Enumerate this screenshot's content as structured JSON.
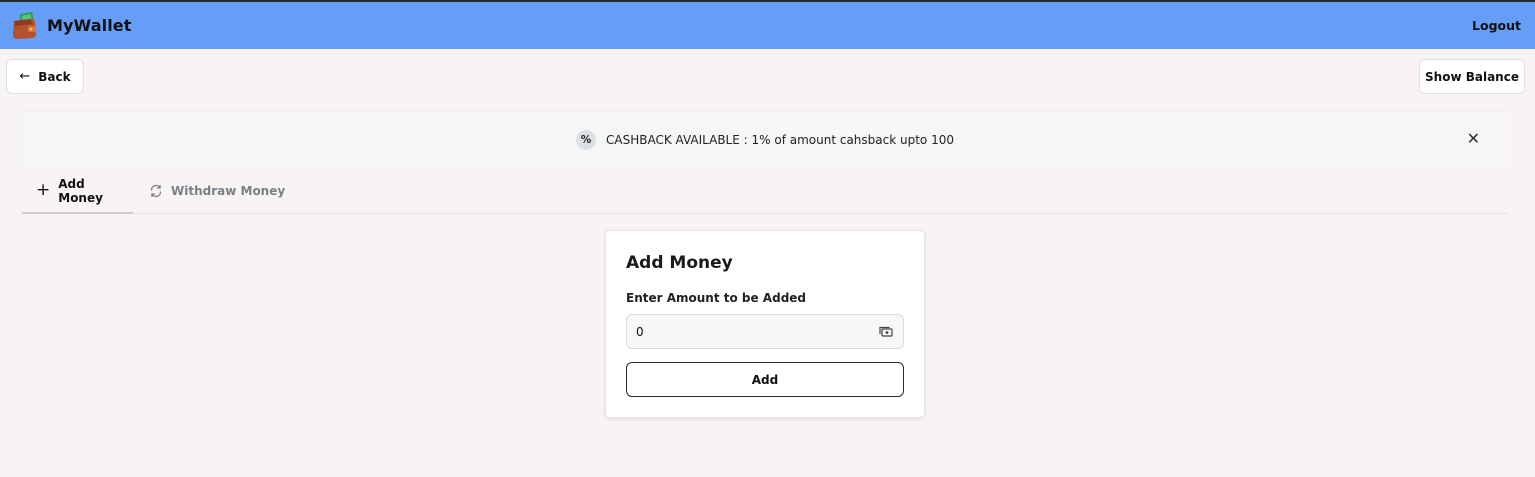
{
  "app": {
    "name": "MyWallet",
    "logout_label": "Logout"
  },
  "actions": {
    "back_label": "Back",
    "show_balance_label": "Show Balance"
  },
  "banner": {
    "badge": "%",
    "text": "CASHBACK AVAILABLE : 1% of amount cahsback upto 100",
    "close_glyph": "✕"
  },
  "tabs": [
    {
      "label": "Add Money",
      "icon": "plus-icon",
      "active": true
    },
    {
      "label": "Withdraw Money",
      "icon": "refresh-icon",
      "active": false
    }
  ],
  "form": {
    "title": "Add Money",
    "amount_label": "Enter Amount to be Added",
    "amount_value": "0",
    "submit_label": "Add"
  },
  "colors": {
    "header": "#659df7",
    "background": "#f7f4f3",
    "banner": "#f4f6f7",
    "inactive_tab": "#7a7f86"
  }
}
